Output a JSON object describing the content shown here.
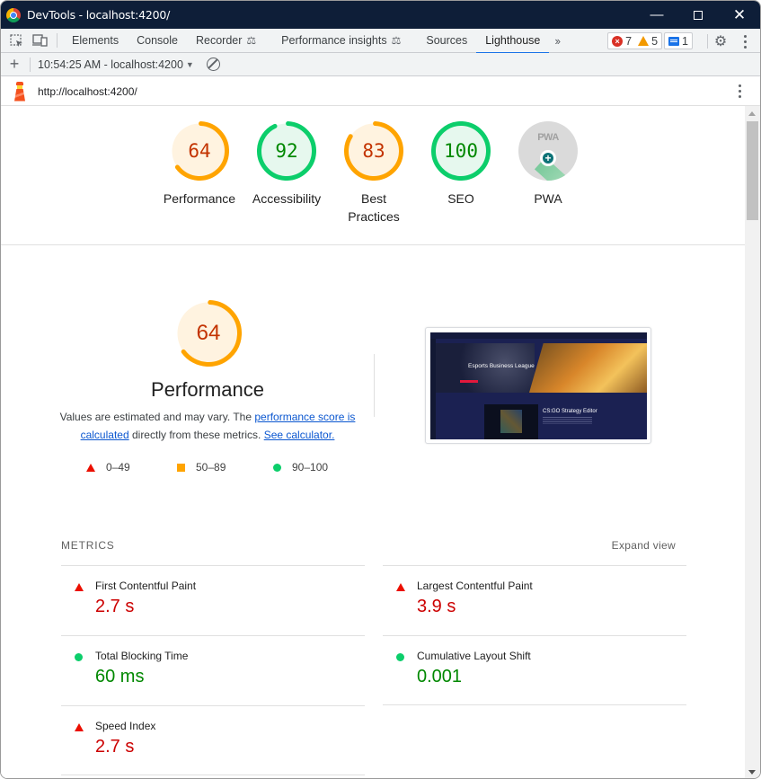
{
  "window": {
    "title": "DevTools - localhost:4200/",
    "controls": [
      "minimize",
      "maximize",
      "close"
    ]
  },
  "tabbar": {
    "tabs": [
      {
        "label": "Elements"
      },
      {
        "label": "Console"
      },
      {
        "label": "Recorder",
        "experimental": true
      },
      {
        "label": "Performance insights",
        "experimental": true
      },
      {
        "label": "Sources"
      },
      {
        "label": "Lighthouse",
        "active": true
      }
    ],
    "more_tabs_icon": "chevron-double-right-icon",
    "issues": {
      "errors": "7",
      "warnings": "5",
      "messages": "1"
    }
  },
  "lighthouse_toolbar": {
    "report_label": "10:54:25 AM - localhost:4200",
    "add_icon": "plus-icon",
    "clear_icon": "block-icon"
  },
  "url": "http://localhost:4200/",
  "gauges": [
    {
      "label": "Performance",
      "score": 64,
      "display": "64",
      "rating": "average"
    },
    {
      "label": "Accessibility",
      "score": 92,
      "display": "92",
      "rating": "pass"
    },
    {
      "label": "Best Practices",
      "score": 83,
      "display": "83",
      "rating": "average"
    },
    {
      "label": "SEO",
      "score": 100,
      "display": "100",
      "rating": "pass"
    },
    {
      "label": "PWA",
      "badge": "PWA"
    }
  ],
  "colors": {
    "average_stroke": "#ffa400",
    "average_fill": "#fff3e0",
    "average_text": "#c33300",
    "pass_stroke": "#0cce6b",
    "pass_fill": "#e6f8ee",
    "pass_text": "#008800",
    "fail": "#eb0f00"
  },
  "performance": {
    "score": 64,
    "display": "64",
    "title": "Performance",
    "desc_prefix": "Values are estimated and may vary. The ",
    "desc_link1": "performance score is calculated",
    "desc_middle": " directly from these metrics. ",
    "desc_link2": "See calculator.",
    "legend": [
      {
        "shape": "triangle",
        "range": "0–49"
      },
      {
        "shape": "square",
        "range": "50–89"
      },
      {
        "shape": "circle",
        "range": "90–100"
      }
    ],
    "screenshot": {
      "hero_title": "Esports Business League",
      "section_title": "CS:GO Strategy Editor"
    }
  },
  "metrics": {
    "heading": "METRICS",
    "expand_label": "Expand view",
    "items": [
      {
        "title": "First Contentful Paint",
        "value": "2.7 s",
        "status": "fail"
      },
      {
        "title": "Largest Contentful Paint",
        "value": "3.9 s",
        "status": "fail"
      },
      {
        "title": "Total Blocking Time",
        "value": "60 ms",
        "status": "pass"
      },
      {
        "title": "Cumulative Layout Shift",
        "value": "0.001",
        "status": "pass"
      },
      {
        "title": "Speed Index",
        "value": "2.7 s",
        "status": "fail"
      }
    ]
  }
}
